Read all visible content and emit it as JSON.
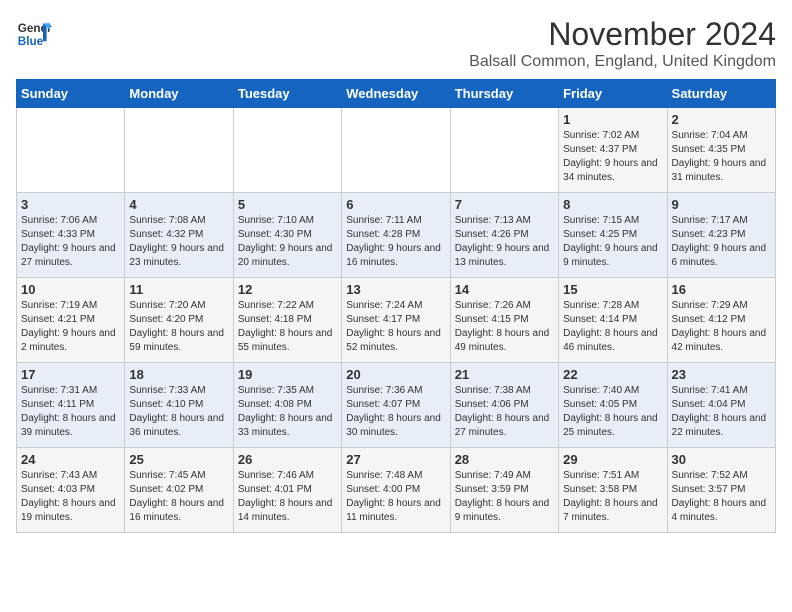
{
  "logo": {
    "line1": "General",
    "line2": "Blue"
  },
  "title": "November 2024",
  "subtitle": "Balsall Common, England, United Kingdom",
  "days_of_week": [
    "Sunday",
    "Monday",
    "Tuesday",
    "Wednesday",
    "Thursday",
    "Friday",
    "Saturday"
  ],
  "weeks": [
    [
      {
        "day": "",
        "info": ""
      },
      {
        "day": "",
        "info": ""
      },
      {
        "day": "",
        "info": ""
      },
      {
        "day": "",
        "info": ""
      },
      {
        "day": "",
        "info": ""
      },
      {
        "day": "1",
        "info": "Sunrise: 7:02 AM\nSunset: 4:37 PM\nDaylight: 9 hours and 34 minutes."
      },
      {
        "day": "2",
        "info": "Sunrise: 7:04 AM\nSunset: 4:35 PM\nDaylight: 9 hours and 31 minutes."
      }
    ],
    [
      {
        "day": "3",
        "info": "Sunrise: 7:06 AM\nSunset: 4:33 PM\nDaylight: 9 hours and 27 minutes."
      },
      {
        "day": "4",
        "info": "Sunrise: 7:08 AM\nSunset: 4:32 PM\nDaylight: 9 hours and 23 minutes."
      },
      {
        "day": "5",
        "info": "Sunrise: 7:10 AM\nSunset: 4:30 PM\nDaylight: 9 hours and 20 minutes."
      },
      {
        "day": "6",
        "info": "Sunrise: 7:11 AM\nSunset: 4:28 PM\nDaylight: 9 hours and 16 minutes."
      },
      {
        "day": "7",
        "info": "Sunrise: 7:13 AM\nSunset: 4:26 PM\nDaylight: 9 hours and 13 minutes."
      },
      {
        "day": "8",
        "info": "Sunrise: 7:15 AM\nSunset: 4:25 PM\nDaylight: 9 hours and 9 minutes."
      },
      {
        "day": "9",
        "info": "Sunrise: 7:17 AM\nSunset: 4:23 PM\nDaylight: 9 hours and 6 minutes."
      }
    ],
    [
      {
        "day": "10",
        "info": "Sunrise: 7:19 AM\nSunset: 4:21 PM\nDaylight: 9 hours and 2 minutes."
      },
      {
        "day": "11",
        "info": "Sunrise: 7:20 AM\nSunset: 4:20 PM\nDaylight: 8 hours and 59 minutes."
      },
      {
        "day": "12",
        "info": "Sunrise: 7:22 AM\nSunset: 4:18 PM\nDaylight: 8 hours and 55 minutes."
      },
      {
        "day": "13",
        "info": "Sunrise: 7:24 AM\nSunset: 4:17 PM\nDaylight: 8 hours and 52 minutes."
      },
      {
        "day": "14",
        "info": "Sunrise: 7:26 AM\nSunset: 4:15 PM\nDaylight: 8 hours and 49 minutes."
      },
      {
        "day": "15",
        "info": "Sunrise: 7:28 AM\nSunset: 4:14 PM\nDaylight: 8 hours and 46 minutes."
      },
      {
        "day": "16",
        "info": "Sunrise: 7:29 AM\nSunset: 4:12 PM\nDaylight: 8 hours and 42 minutes."
      }
    ],
    [
      {
        "day": "17",
        "info": "Sunrise: 7:31 AM\nSunset: 4:11 PM\nDaylight: 8 hours and 39 minutes."
      },
      {
        "day": "18",
        "info": "Sunrise: 7:33 AM\nSunset: 4:10 PM\nDaylight: 8 hours and 36 minutes."
      },
      {
        "day": "19",
        "info": "Sunrise: 7:35 AM\nSunset: 4:08 PM\nDaylight: 8 hours and 33 minutes."
      },
      {
        "day": "20",
        "info": "Sunrise: 7:36 AM\nSunset: 4:07 PM\nDaylight: 8 hours and 30 minutes."
      },
      {
        "day": "21",
        "info": "Sunrise: 7:38 AM\nSunset: 4:06 PM\nDaylight: 8 hours and 27 minutes."
      },
      {
        "day": "22",
        "info": "Sunrise: 7:40 AM\nSunset: 4:05 PM\nDaylight: 8 hours and 25 minutes."
      },
      {
        "day": "23",
        "info": "Sunrise: 7:41 AM\nSunset: 4:04 PM\nDaylight: 8 hours and 22 minutes."
      }
    ],
    [
      {
        "day": "24",
        "info": "Sunrise: 7:43 AM\nSunset: 4:03 PM\nDaylight: 8 hours and 19 minutes."
      },
      {
        "day": "25",
        "info": "Sunrise: 7:45 AM\nSunset: 4:02 PM\nDaylight: 8 hours and 16 minutes."
      },
      {
        "day": "26",
        "info": "Sunrise: 7:46 AM\nSunset: 4:01 PM\nDaylight: 8 hours and 14 minutes."
      },
      {
        "day": "27",
        "info": "Sunrise: 7:48 AM\nSunset: 4:00 PM\nDaylight: 8 hours and 11 minutes."
      },
      {
        "day": "28",
        "info": "Sunrise: 7:49 AM\nSunset: 3:59 PM\nDaylight: 8 hours and 9 minutes."
      },
      {
        "day": "29",
        "info": "Sunrise: 7:51 AM\nSunset: 3:58 PM\nDaylight: 8 hours and 7 minutes."
      },
      {
        "day": "30",
        "info": "Sunrise: 7:52 AM\nSunset: 3:57 PM\nDaylight: 8 hours and 4 minutes."
      }
    ]
  ],
  "colors": {
    "header_bg": "#1565C0",
    "odd_row": "#f5f5f5",
    "even_row": "#e8eef7"
  }
}
